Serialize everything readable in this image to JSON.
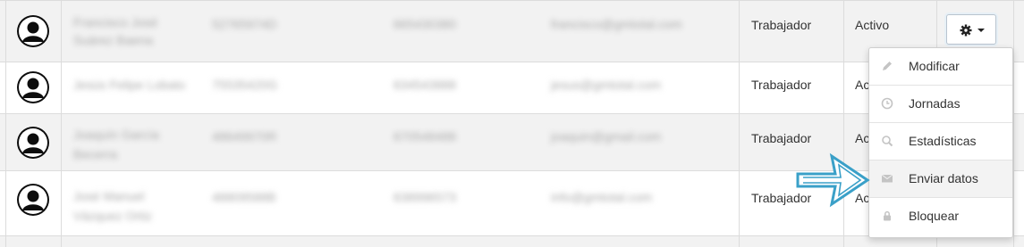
{
  "rows": [
    {
      "name_1": "Francisco José",
      "name_2": "Suárez Baena",
      "dni": "52765974D",
      "phone": "665430380",
      "email": "francisco@gmtotal.com",
      "role": "Trabajador",
      "status": "Activo"
    },
    {
      "name_1": "Jesús Felipe Lobato",
      "name_2": "",
      "dni": "75535420G",
      "phone": "634543888",
      "email": "jesus@gmtotal.com",
      "role": "Trabajador",
      "status": "Activo"
    },
    {
      "name_1": "Joaquín García",
      "name_2": "Becerra",
      "dni": "48649970R",
      "phone": "670548488",
      "email": "joaquin@gmail.com",
      "role": "Trabajador",
      "status": "Activo"
    },
    {
      "name_1": "José Manuel",
      "name_2": "Vázquez Ortiz",
      "dni": "48809588B",
      "phone": "638996573",
      "email": "info@gmtotal.com",
      "role": "Trabajador",
      "status": "Activo"
    }
  ],
  "status_visible": [
    "Activo",
    "Ac",
    "Ac",
    "Ac"
  ],
  "menu": {
    "items": [
      {
        "label": "Modificar",
        "icon": "pencil-icon"
      },
      {
        "label": "Jornadas",
        "icon": "clock-icon"
      },
      {
        "label": "Estadísticas",
        "icon": "search-icon"
      },
      {
        "label": "Enviar datos",
        "icon": "envelope-icon"
      },
      {
        "label": "Bloquear",
        "icon": "lock-icon"
      }
    ]
  },
  "colors": {
    "arrow": "#3aa0c8",
    "menu_highlight": "#f3f3f3",
    "row_alt": "#f2f2f2"
  }
}
